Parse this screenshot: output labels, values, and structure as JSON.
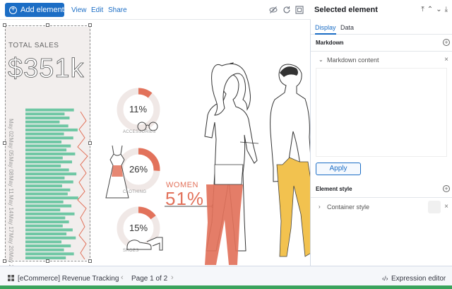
{
  "toolbar": {
    "add_element": "Add element",
    "view": "View",
    "edit": "Edit",
    "share": "Share",
    "icons": [
      "hide-icon",
      "refresh-icon",
      "fullscreen-icon"
    ]
  },
  "workpad": {
    "total_label": "TOTAL SALES",
    "total_amount": "$351k",
    "date_labels": [
      "May 02",
      "May 05",
      "May 08",
      "May 11",
      "May 14",
      "May 17",
      "May 20",
      "May 23"
    ],
    "bar_values": [
      0.78,
      0.63,
      0.71,
      0.55,
      0.69,
      0.84,
      0.62,
      0.77,
      0.58,
      0.73,
      0.66,
      0.8,
      0.6,
      0.75,
      0.57,
      0.7,
      0.82,
      0.63,
      0.77,
      0.59,
      0.72,
      0.68,
      0.85,
      0.61,
      0.74,
      0.56,
      0.79,
      0.64,
      0.7,
      0.6,
      0.76,
      0.66,
      0.81,
      0.58,
      0.73,
      0.62,
      0.78,
      0.65
    ],
    "donuts": [
      {
        "pct": "11%",
        "value": 0.11,
        "label": "ACCESSORIES"
      },
      {
        "pct": "26%",
        "value": 0.26,
        "label": "CLOTHING"
      },
      {
        "pct": "15%",
        "value": 0.15,
        "label": "SHOES"
      }
    ],
    "women_label": "WOMEN",
    "women_pct": "51%",
    "colors": {
      "bars": "#6fc7a4",
      "accent": "#e2725b",
      "men": "#f2c24f",
      "panel": "#f2eeed"
    }
  },
  "panel": {
    "title": "Selected element",
    "tabs": [
      "Display",
      "Data"
    ],
    "markdown_section": "Markdown",
    "markdown_content": "Markdown content",
    "apply": "Apply",
    "element_style": "Element style",
    "container_style": "Container style"
  },
  "footer": {
    "workpad_name": "[eCommerce] Revenue Tracking",
    "page": "Page 1 of 2",
    "expression_editor": "Expression editor"
  }
}
